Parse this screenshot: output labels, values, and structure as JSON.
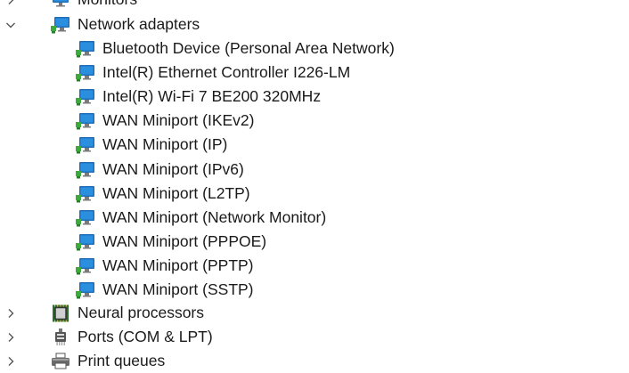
{
  "tree": {
    "top_partial": {
      "label": "Monitors",
      "expanded": false
    },
    "network_adapters": {
      "label": "Network adapters",
      "expanded": true,
      "children": [
        "Bluetooth Device (Personal Area Network)",
        "Intel(R) Ethernet Controller I226-LM",
        "Intel(R) Wi-Fi 7 BE200 320MHz",
        "WAN Miniport (IKEv2)",
        "WAN Miniport (IP)",
        "WAN Miniport (IPv6)",
        "WAN Miniport (L2TP)",
        "WAN Miniport (Network Monitor)",
        "WAN Miniport (PPPOE)",
        "WAN Miniport (PPTP)",
        "WAN Miniport (SSTP)"
      ]
    },
    "after": [
      {
        "label": "Neural processors",
        "icon": "chip-icon",
        "expanded": false
      },
      {
        "label": "Ports (COM & LPT)",
        "icon": "port-icon",
        "expanded": false
      },
      {
        "label": "Print queues",
        "icon": "printer-icon",
        "expanded": false
      }
    ]
  },
  "colors": {
    "text": "#1a1a1a",
    "chevron": "#555555",
    "monitor_blue": "#2b8fe0",
    "monitor_frame": "#1f6fb8",
    "cable_green": "#3caa3c"
  }
}
